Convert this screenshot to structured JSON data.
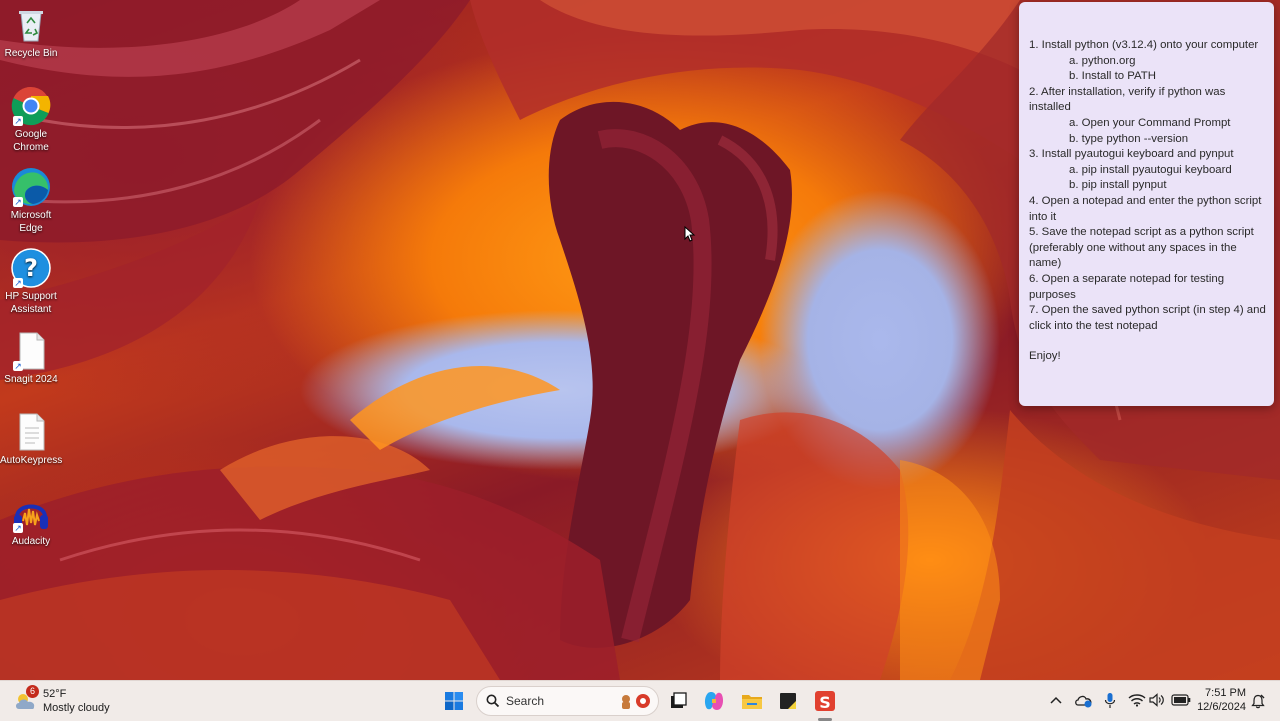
{
  "desktop": {
    "icons": [
      {
        "label": "Recycle Bin",
        "icon": "recycle-bin-icon"
      },
      {
        "label": "Google Chrome",
        "icon": "chrome-icon"
      },
      {
        "label": "Microsoft Edge",
        "icon": "edge-icon"
      },
      {
        "label": "HP Support Assistant",
        "icon": "hp-support-icon"
      },
      {
        "label": "Snagit 2024",
        "icon": "document-icon"
      },
      {
        "label": "AutoKeypress",
        "icon": "document-icon"
      },
      {
        "label": "Audacity",
        "icon": "audacity-icon"
      }
    ]
  },
  "note": {
    "lines": [
      "1. Install python (v3.12.4) onto your computer",
      "a. python.org",
      "b. Install to PATH",
      "2. After installation, verify if python was installed",
      "a. Open your Command Prompt",
      "b. type python --version",
      "3. Install pyautogui keyboard and pynput",
      "a. pip install pyautogui keyboard",
      "b. pip install pynput",
      "4. Open a notepad and enter the python script into it",
      "5. Save the notepad script as a python script (preferably one without any spaces in the name)",
      "6. Open a separate notepad for testing purposes",
      "7. Open the saved python script (in step 4) and click into the test notepad",
      "Enjoy!"
    ]
  },
  "taskbar": {
    "weather": {
      "badge": "6",
      "temp": "52°F",
      "condition": "Mostly cloudy"
    },
    "search_label": "Search",
    "apps": [
      "start-icon",
      "task-view-icon",
      "copilot-icon",
      "file-explorer-icon",
      "sticky-notes-icon",
      "snagit-icon"
    ],
    "tray_icons": [
      "chevron-up-icon",
      "onedrive-icon",
      "microphone-icon",
      "wifi-icon",
      "volume-icon",
      "battery-icon"
    ],
    "time": "7:51 PM",
    "date": "12/6/2024"
  },
  "colors": {
    "note_bg": "#ebe3f8",
    "taskbar_bg": "#f1ebe8",
    "accent": "#0067c0"
  }
}
